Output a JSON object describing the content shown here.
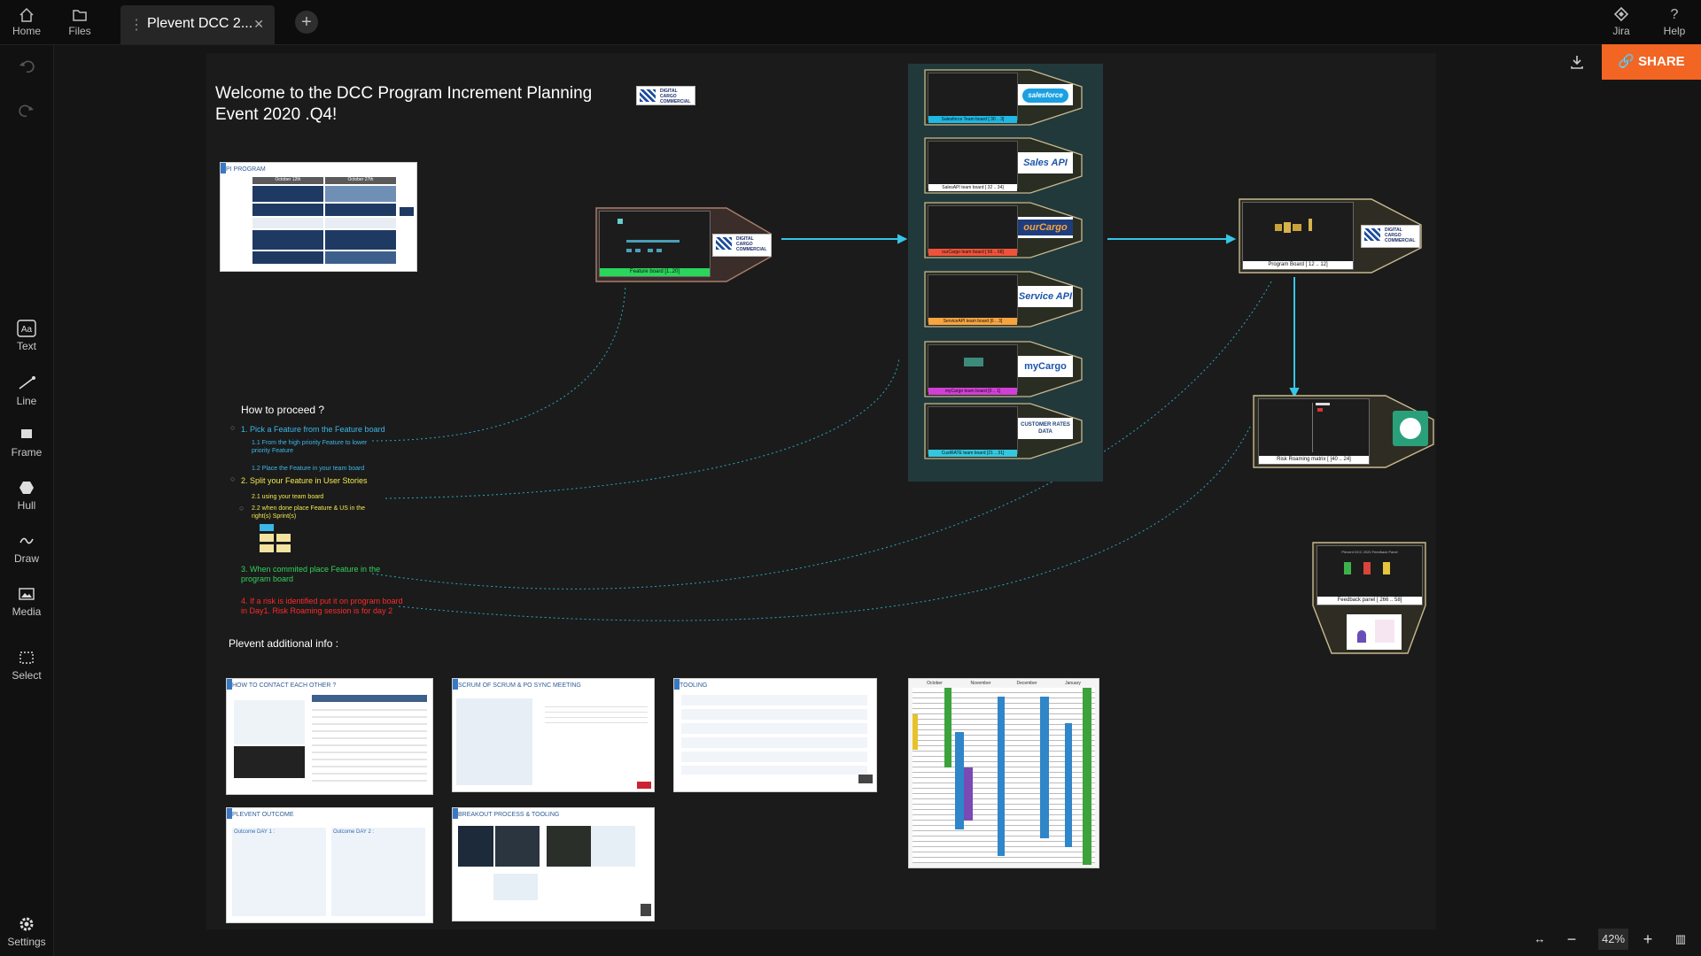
{
  "topbar": {
    "home": "Home",
    "files": "Files",
    "tab_title": "Plevent DCC 2...",
    "jira": "Jira",
    "help": "Help"
  },
  "toolbar": {
    "text": "Text",
    "line": "Line",
    "frame": "Frame",
    "hull": "Hull",
    "draw": "Draw",
    "media": "Media",
    "select": "Select",
    "settings": "Settings"
  },
  "share": {
    "label": "SHARE"
  },
  "zoom": {
    "value": "42%"
  },
  "board": {
    "title": "Welcome to the DCC Program Increment Planning Event 2020 .Q4!",
    "company_logo": "DIGITAL CARGO COMMERCIAL",
    "pi_slide_title": "PI PROGRAM",
    "pi_slide_cols": [
      "October 12th",
      "October 27th"
    ],
    "feature_board_label": "Feature board [1..20]",
    "team_boards": [
      {
        "label": "Salesforce Team board [ 30 .. 3]",
        "logo": "salesforce",
        "color": "#1fb8e4"
      },
      {
        "label": "SalesAPI team board [ 32 .. 34]",
        "logo": "Sales API",
        "color": "#ffffff"
      },
      {
        "label": "ourCargo team board [ 66 .. 68]",
        "logo": "ourCargo",
        "color": "#f0533a"
      },
      {
        "label": "ServiceAPI team board [6 .. 3]",
        "logo": "Service API",
        "color": "#f7a440"
      },
      {
        "label": "myCargo team board [0 .. 1]",
        "logo": "myCargo",
        "color": "#d23fd6"
      },
      {
        "label": "CustRATE team board [21 .. 31]",
        "logo": "CUSTOMER RATES DATA",
        "color": "#33c8e0"
      }
    ],
    "program_board_label": "Program Board [ 12 .. 12]",
    "risk_board_label": "Risk Roaming matrix [ [40 .. 24]",
    "feedback_board_label": "Feedback panel [ 266 .. 58]",
    "feedback_board_title": "Plevent DCC 2020 Feedback Panel",
    "how_to": {
      "heading": "How to proceed ?",
      "steps": [
        {
          "text": "1. Pick a Feature from the Feature board",
          "color": "#3bb8e8"
        },
        {
          "text": "1.1 From the high priority Feature to lower priority Feature",
          "color": "#3bb8e8"
        },
        {
          "text": "1.2 Place the Feature in your team board",
          "color": "#3bb8e8"
        },
        {
          "text": "2. Split your Feature in User Stories",
          "color": "#f2e94e"
        },
        {
          "text": "2.1 using your team board",
          "color": "#f2e94e"
        },
        {
          "text": "2.2 when done place Feature & US in the right(s) Sprint(s)",
          "color": "#f2e94e"
        },
        {
          "text": "3. When commited place Feature in the program board",
          "color": "#33d15b"
        },
        {
          "text": "4. If a risk is identified put it on program board in Day1. Risk Roaming session is for day 2",
          "color": "#ff2a2a"
        }
      ]
    },
    "additional_info": "Plevent additional info :",
    "info_slides": [
      "HOW TO CONTACT EACH OTHER ?",
      "SCRUM OF SCRUM & PO SYNC MEETING",
      "TOOLING",
      "PLEVENT OUTCOME",
      "BREAKOUT PROCESS & TOOLING"
    ],
    "outcome_day1": "Outcome DAY 1 :",
    "outcome_day2": "Outcome DAY 2 :",
    "calendar_months": [
      "October",
      "November",
      "December",
      "January"
    ]
  }
}
